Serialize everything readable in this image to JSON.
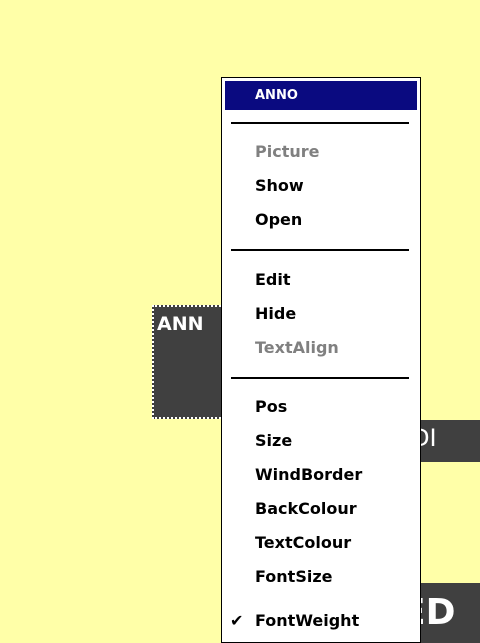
{
  "objects": {
    "anno_label": "ANN",
    "idi_label": "IDI",
    "ed_label": "ED"
  },
  "menu": {
    "title": "ANNO",
    "title_color": "#0A0A80",
    "groups": [
      [
        {
          "label": "Picture",
          "enabled": false
        },
        {
          "label": "Show",
          "enabled": true
        },
        {
          "label": "Open",
          "enabled": true
        }
      ],
      [
        {
          "label": "Edit",
          "enabled": true
        },
        {
          "label": "Hide",
          "enabled": true
        },
        {
          "label": "TextAlign",
          "enabled": false
        }
      ],
      [
        {
          "label": "Pos",
          "enabled": true
        },
        {
          "label": "Size",
          "enabled": true
        },
        {
          "label": "WindBorder",
          "enabled": true
        },
        {
          "label": "BackColour",
          "enabled": true
        },
        {
          "label": "TextColour",
          "enabled": true
        },
        {
          "label": "FontSize",
          "enabled": true
        },
        {
          "label": "FontWeight",
          "enabled": true,
          "checked": true
        }
      ]
    ]
  },
  "colors": {
    "background": "#FFFFA8",
    "object_fill": "#404040",
    "disabled_text": "#808080"
  },
  "icons": {
    "checked": "check-icon"
  }
}
